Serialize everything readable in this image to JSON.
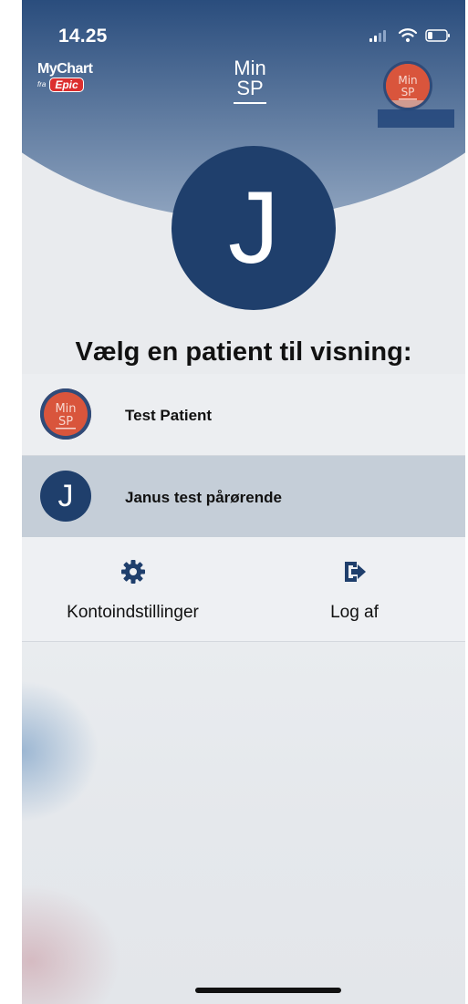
{
  "status": {
    "time": "14.25"
  },
  "header": {
    "left_logo": {
      "word": "MyChart",
      "fra": "fra",
      "epic": "Epic"
    },
    "center_logo": {
      "line1": "Min",
      "line2": "SP"
    },
    "right_logo": {
      "line1": "Min",
      "line2": "SP"
    }
  },
  "current_patient": {
    "initial": "J"
  },
  "main": {
    "title": "Vælg en patient til visning:"
  },
  "patients": [
    {
      "name": "Test Patient",
      "avatar_line1": "Min",
      "avatar_line2": "SP"
    },
    {
      "name": "Janus test pårørende",
      "avatar_initial": "J",
      "selected": true
    }
  ],
  "actions": {
    "settings_label": "Kontoindstillinger",
    "logout_label": "Log af"
  },
  "icons": {
    "settings": "gear-icon",
    "logout": "sign-out-icon",
    "signal": "signal-icon",
    "wifi": "wifi-icon",
    "battery": "battery-icon"
  },
  "colors": {
    "brand_navy": "#1f3f6c",
    "brand_orange": "#d9553c",
    "selected_row": "#c5ced8"
  }
}
